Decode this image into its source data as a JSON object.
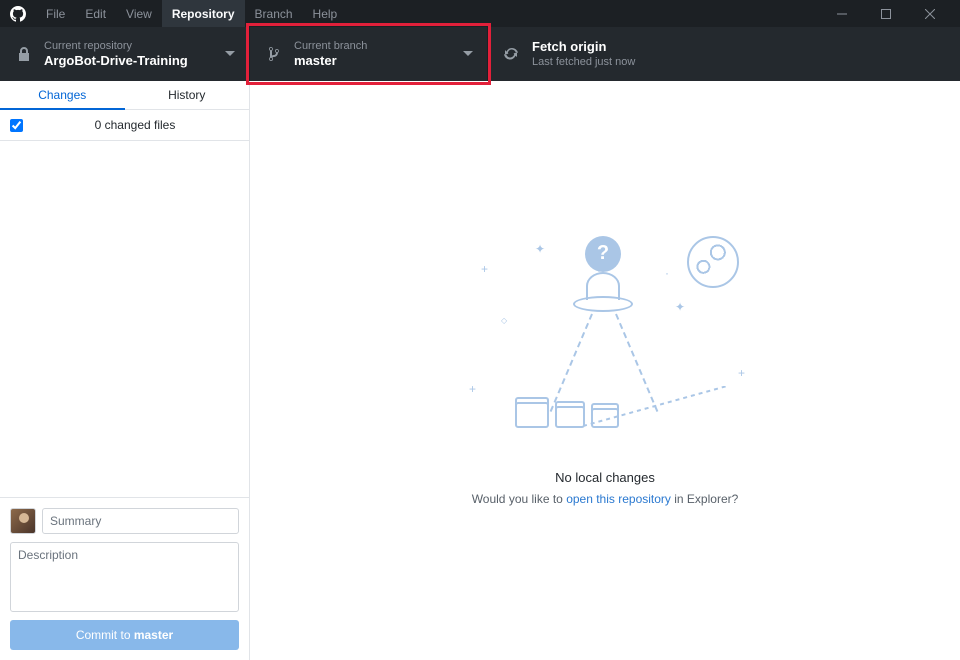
{
  "menubar": {
    "items": [
      "File",
      "Edit",
      "View",
      "Repository",
      "Branch",
      "Help"
    ],
    "active_index": 3
  },
  "toolbar": {
    "repo": {
      "label": "Current repository",
      "value": "ArgoBot-Drive-Training"
    },
    "branch": {
      "label": "Current branch",
      "value": "master"
    },
    "fetch": {
      "label": "Fetch origin",
      "value": "Last fetched just now"
    }
  },
  "sidebar": {
    "tabs": [
      "Changes",
      "History"
    ],
    "active_tab": 0,
    "changes_header": "0 changed files",
    "summary_placeholder": "Summary",
    "description_placeholder": "Description",
    "commit_prefix": "Commit to ",
    "commit_branch": "master"
  },
  "main": {
    "title": "No local changes",
    "sub_prefix": "Would you like to ",
    "sub_link": "open this repository",
    "sub_suffix": " in Explorer?",
    "bubble_char": "?"
  }
}
